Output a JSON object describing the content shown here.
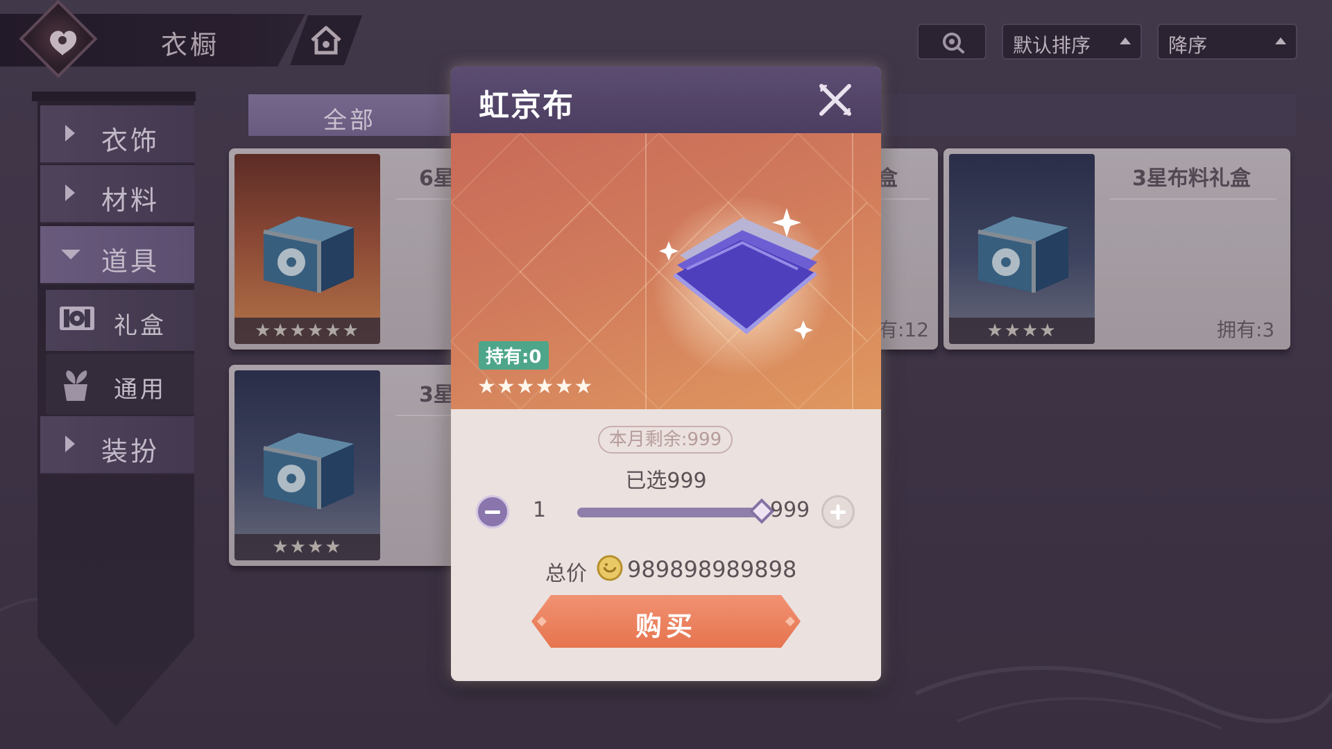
{
  "header": {
    "title": "衣橱",
    "home_icon": "home-icon",
    "search_icon": "search-icon",
    "sort": {
      "label": "默认排序"
    },
    "order": {
      "label": "降序"
    }
  },
  "sidebar": {
    "items": [
      {
        "label": "衣饰",
        "expanded": false
      },
      {
        "label": "材料",
        "expanded": false
      },
      {
        "label": "道具",
        "expanded": true
      },
      {
        "label": "装扮",
        "expanded": false
      }
    ],
    "sub_items": [
      {
        "label": "礼盒",
        "icon": "gift-box-icon",
        "selected": true
      },
      {
        "label": "通用",
        "icon": "leaf-bag-icon",
        "selected": false
      }
    ]
  },
  "tabs": {
    "all_label": "全部"
  },
  "cards": [
    {
      "title": "6星",
      "stars": "★★★★★★",
      "rarity": 6,
      "owned": ""
    },
    {
      "title": "盒",
      "stars": "",
      "rarity": 0,
      "owned": "有:12"
    },
    {
      "title": "3星布料礼盒",
      "stars": "★★★★",
      "rarity": 4,
      "owned": "拥有:3"
    },
    {
      "title": "3星",
      "stars": "★★★★",
      "rarity": 4,
      "owned": ""
    }
  ],
  "modal": {
    "title": "虹京布",
    "close_icon": "close-icon",
    "owned_badge": "持有:0",
    "stars": "★★★★★★",
    "remaining": "本月剩余:999",
    "selected_text": "已选999",
    "slider": {
      "min_label": "1",
      "max_label": "999",
      "fraction": 1.0
    },
    "total_label": "总价",
    "coin_icon": "coin-icon",
    "total_value": "989898989898",
    "buy_label": "购买"
  },
  "colors": {
    "accent_purple": "#8a75ad",
    "buy_button": "#e6744f",
    "owned_badge": "#4ea68a"
  }
}
